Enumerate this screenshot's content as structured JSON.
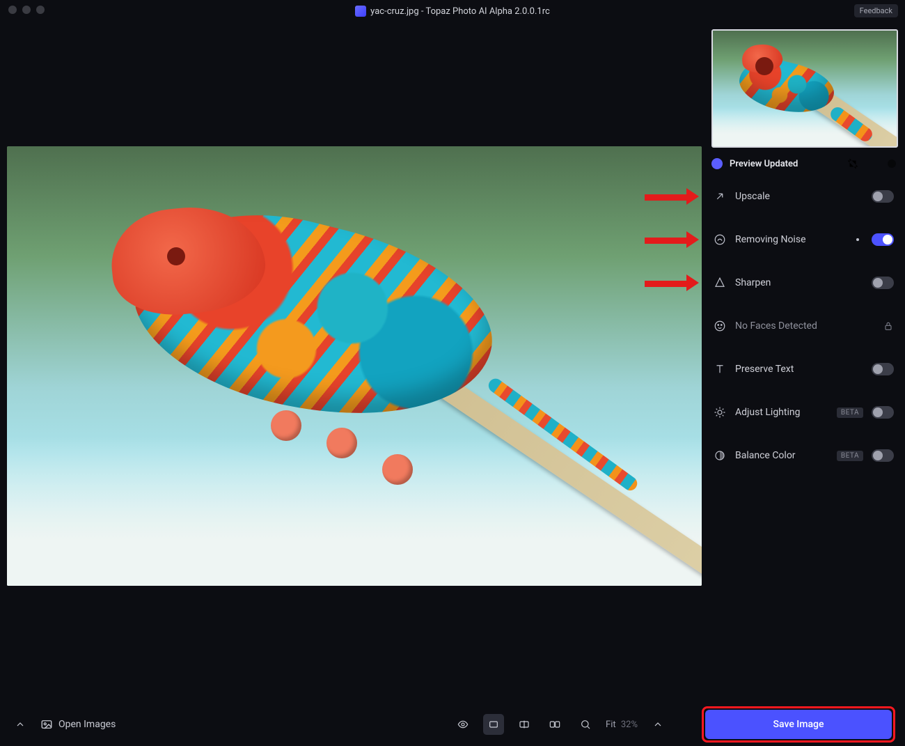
{
  "titlebar": {
    "title": "yac-cruz.jpg - Topaz Photo AI Alpha 2.0.0.1rc",
    "feedback_label": "Feedback"
  },
  "panel": {
    "status_label": "Preview Updated",
    "options": {
      "upscale": {
        "label": "Upscale",
        "on": false,
        "arrow": true
      },
      "removing_noise": {
        "label": "Removing Noise",
        "on": true,
        "arrow": true,
        "indicator": true
      },
      "sharpen": {
        "label": "Sharpen",
        "on": false,
        "arrow": true
      },
      "faces": {
        "label": "No Faces Detected"
      },
      "preserve_text": {
        "label": "Preserve Text",
        "on": false
      },
      "adjust_light": {
        "label": "Adjust Lighting",
        "on": false,
        "beta": "BETA"
      },
      "balance_color": {
        "label": "Balance Color",
        "on": false,
        "beta": "BETA"
      }
    }
  },
  "bottombar": {
    "open_images_label": "Open Images",
    "fit_label": "Fit",
    "fit_value": "32%",
    "save_label": "Save Image"
  }
}
